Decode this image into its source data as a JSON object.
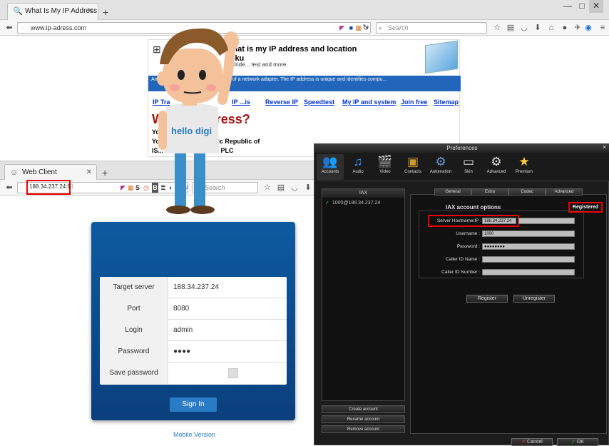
{
  "browser_top": {
    "tab_title": "What Is My IP Address At I...",
    "new_tab": "+",
    "url": "www.ip-adress.com",
    "search_placeholder": "Search",
    "window_controls": {
      "minimize": "—",
      "maximize": "□",
      "close": "✕"
    }
  },
  "site": {
    "title_line1": "What is my IP address and location",
    "title_line2": "ooku",
    "subtitle": "s finde... test and more.",
    "blue_bar_text": "An IP ... l Address ... logical address of a network adapter. The IP address is unique and identifies compu...",
    "nav": [
      "IP Tra",
      "IP ...is",
      "Reverse IP",
      "Speedtest",
      "My IP and system",
      "Join free",
      "Sitemap"
    ],
    "heading": "W... IP address?",
    "ip_line": "Yo... 27.95.55",
    "country_line": "Yo... on: in Iran, Islamic Republic of",
    "isp_line": "IS... Data Transfer Inc. PLC",
    "logo_alt": "network-diagram"
  },
  "browser_client": {
    "tab_title": "Web Client",
    "new_tab": "+",
    "url": "188.34.237.24:8",
    "url_suffix": "1",
    "search_placeholder": "Search",
    "ext_letters": [
      "S",
      "B"
    ]
  },
  "login": {
    "fields": [
      {
        "label": "Target server",
        "value": "188.34.237.24"
      },
      {
        "label": "Port",
        "value": "8080"
      },
      {
        "label": "Login",
        "value": "admin"
      },
      {
        "label": "Password",
        "value": "●●●●"
      },
      {
        "label": "Save password",
        "value": ""
      }
    ],
    "sign_in": "Sign In",
    "mobile_version": "Mobile Version"
  },
  "cartoon": {
    "shirt_text": "hello digi"
  },
  "preferences": {
    "title": "Preferences",
    "toolbar": [
      "Accounts",
      "Audio",
      "Video",
      "Contacts",
      "Automation",
      "Skin",
      "Advanced",
      "Premium"
    ],
    "account_list_header": "IAX",
    "account_item": "1000@188.34.237.24",
    "buttons_left": [
      "Create account",
      "Rename account",
      "Remove account"
    ],
    "tabs": [
      "General",
      "Extra",
      "Codec",
      "Advanced"
    ],
    "section_title": "IAX account options",
    "status": "Registered",
    "fields": [
      {
        "label": "Server Hostname/IP :",
        "value": "188.34.237.24"
      },
      {
        "label": "Username :",
        "value": "1000"
      },
      {
        "label": "Password :",
        "value": "●●●●●●●●"
      },
      {
        "label": "Caller ID Name :",
        "value": ""
      },
      {
        "label": "Caller ID Number :",
        "value": ""
      }
    ],
    "register": "Register",
    "unregister": "Unregister",
    "cancel": "Cancel",
    "ok": "OK"
  },
  "colors": {
    "accent_blue": "#2266bb",
    "highlight_red": "#ee0000",
    "card_blue": "#0d5aa0"
  }
}
